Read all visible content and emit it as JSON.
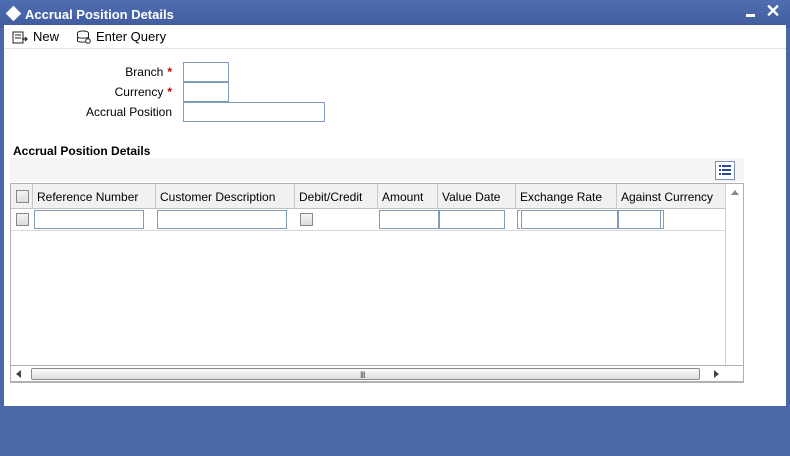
{
  "window": {
    "title": "Accrual Position Details"
  },
  "toolbar": {
    "new_label": "New",
    "enter_query_label": "Enter Query"
  },
  "form": {
    "branch_label": "Branch",
    "currency_label": "Currency",
    "accrual_position_label": "Accrual Position",
    "required_marker": "*",
    "branch_value": "",
    "currency_value": "",
    "accrual_position_value": ""
  },
  "section": {
    "title": "Accrual Position Details"
  },
  "grid": {
    "columns": [
      "Reference Number",
      "Customer Description",
      "Debit/Credit",
      "Amount",
      "Value Date",
      "Exchange Rate",
      "Against Currency"
    ]
  },
  "scrollbar": {
    "grip": "III"
  }
}
